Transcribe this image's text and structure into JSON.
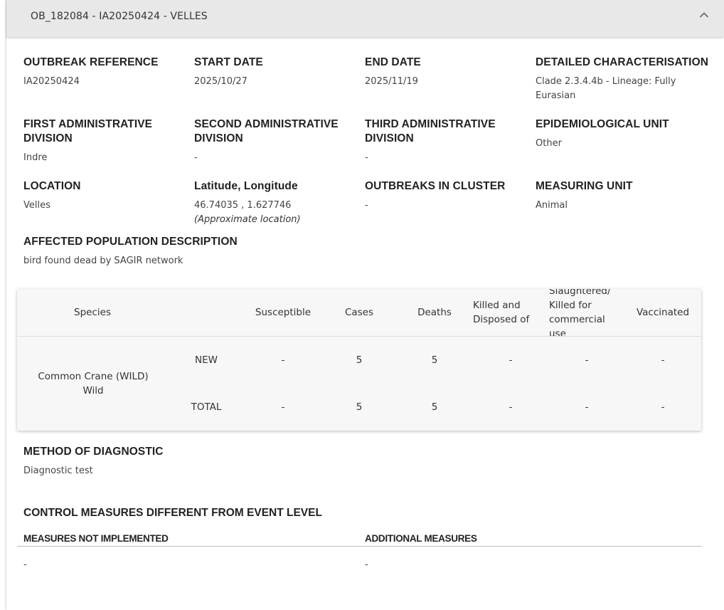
{
  "header": {
    "title": "OB_182084 - IA20250424 - VELLES",
    "collapse_icon": "chevron-up-icon"
  },
  "fields": {
    "outbreak_reference": {
      "label": "OUTBREAK REFERENCE",
      "value": "IA20250424"
    },
    "start_date": {
      "label": "START DATE",
      "value": "2025/10/27"
    },
    "end_date": {
      "label": "END DATE",
      "value": "2025/11/19"
    },
    "detailed_characterisation": {
      "label": "DETAILED CHARACTERISATION",
      "value": "Clade 2.3.4.4b - Lineage: Fully Eurasian"
    },
    "first_admin_division": {
      "label": "FIRST ADMINISTRATIVE DIVISION",
      "value": "Indre"
    },
    "second_admin_division": {
      "label": "SECOND ADMINISTRATIVE DIVISION",
      "value": "-"
    },
    "third_admin_division": {
      "label": "THIRD ADMINISTRATIVE DIVISION",
      "value": "-"
    },
    "epidemiological_unit": {
      "label": "EPIDEMIOLOGICAL UNIT",
      "value": "Other"
    },
    "location": {
      "label": "LOCATION",
      "value": "Velles"
    },
    "lat_long": {
      "label": "Latitude, Longitude",
      "value": "46.74035 , 1.627746",
      "note": "(Approximate location)"
    },
    "outbreaks_in_cluster": {
      "label": "OUTBREAKS IN CLUSTER",
      "value": "-"
    },
    "measuring_unit": {
      "label": "MEASURING UNIT",
      "value": "Animal"
    },
    "affected_population": {
      "label": "AFFECTED POPULATION DESCRIPTION",
      "value": "bird found dead by SAGIR network"
    }
  },
  "species_table": {
    "headers": {
      "species": "Species",
      "susceptible": "Susceptible",
      "cases": "Cases",
      "deaths": "Deaths",
      "killed_disposed": "Killed and Disposed of",
      "slaughtered": "Slaughtered/ Killed for commercial use",
      "vaccinated": "Vaccinated"
    },
    "species_name": "Common Crane (WILD)",
    "species_type": "Wild",
    "rows": [
      {
        "type": "NEW",
        "susceptible": "-",
        "cases": "5",
        "deaths": "5",
        "killed_disposed": "-",
        "slaughtered": "-",
        "vaccinated": "-"
      },
      {
        "type": "TOTAL",
        "susceptible": "-",
        "cases": "5",
        "deaths": "5",
        "killed_disposed": "-",
        "slaughtered": "-",
        "vaccinated": "-"
      }
    ]
  },
  "diagnostic": {
    "label": "METHOD OF DIAGNOSTIC",
    "value": "Diagnostic test"
  },
  "control_measures": {
    "title": "CONTROL MEASURES DIFFERENT FROM EVENT LEVEL",
    "not_implemented_label": "MEASURES NOT IMPLEMENTED",
    "not_implemented_value": "-",
    "additional_label": "ADDITIONAL MEASURES",
    "additional_value": "-"
  }
}
